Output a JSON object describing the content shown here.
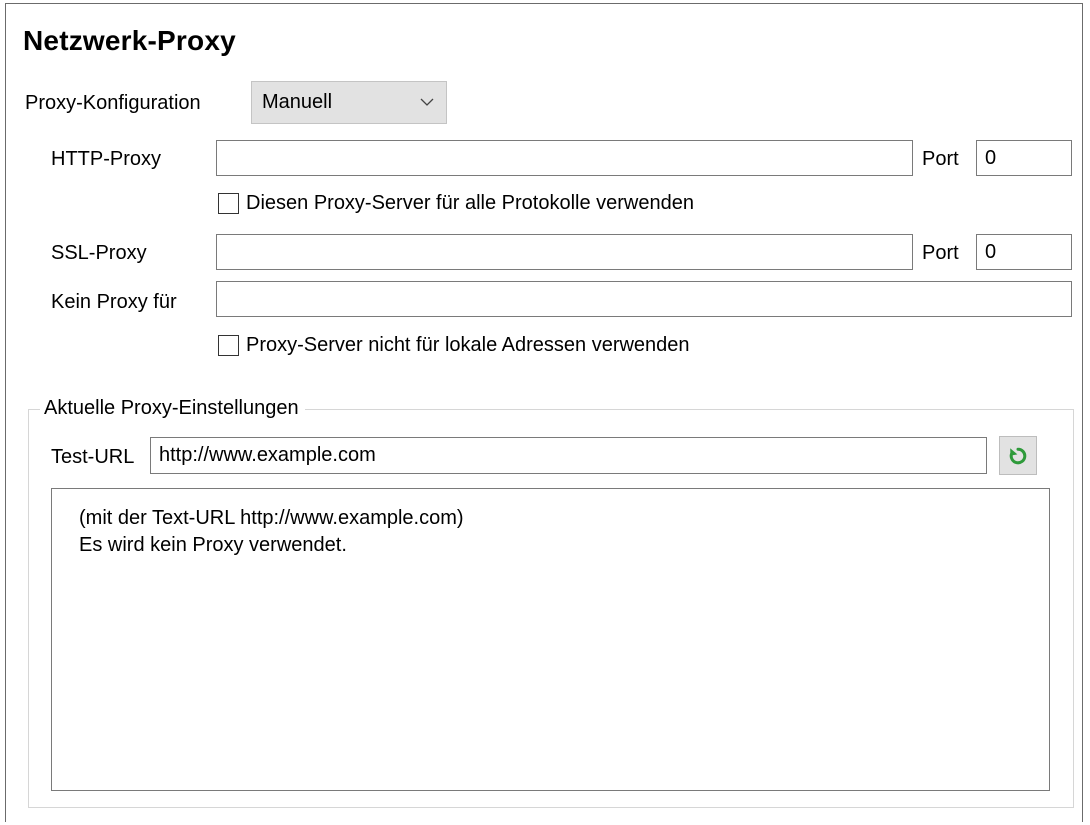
{
  "title": "Netzwerk-Proxy",
  "proxy_config": {
    "label": "Proxy-Konfiguration",
    "selected": "Manuell"
  },
  "http_proxy": {
    "label": "HTTP-Proxy",
    "value": "",
    "port_label": "Port",
    "port_value": "0"
  },
  "use_for_all": {
    "label": "Diesen Proxy-Server für alle Protokolle verwenden",
    "checked": false
  },
  "ssl_proxy": {
    "label": "SSL-Proxy",
    "value": "",
    "port_label": "Port",
    "port_value": "0"
  },
  "no_proxy": {
    "label": "Kein Proxy für",
    "value": ""
  },
  "bypass_local": {
    "label": "Proxy-Server nicht für lokale Adressen verwenden",
    "checked": false
  },
  "current_settings": {
    "group_label": "Aktuelle Proxy-Einstellungen",
    "test_url_label": "Test-URL",
    "test_url_value": "http://www.example.com",
    "refresh_icon": "refresh-icon",
    "output_lines": [
      "(mit der Text-URL http://www.example.com)",
      "Es wird kein Proxy verwendet."
    ]
  },
  "colors": {
    "refresh_green": "#2e9a3a",
    "button_bg": "#e2e2e2"
  }
}
